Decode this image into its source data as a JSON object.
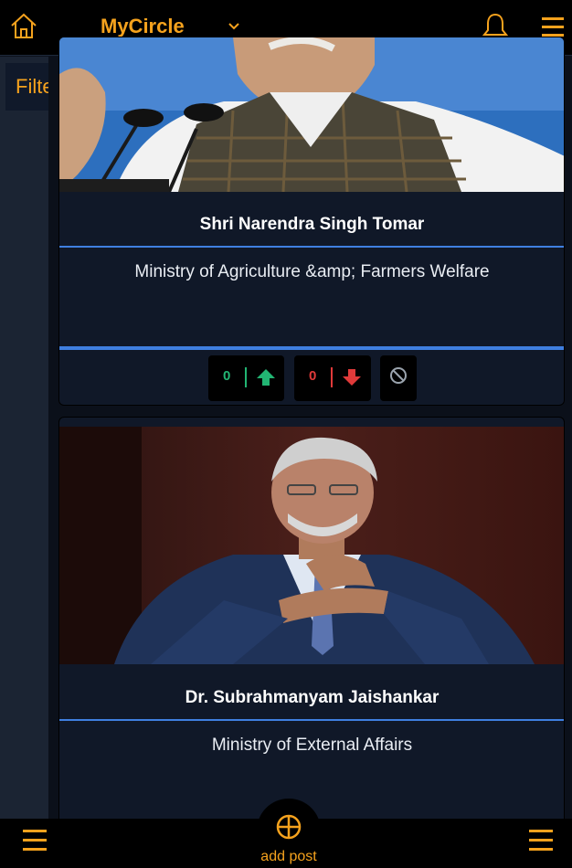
{
  "header": {
    "brand": "MyCircle",
    "accent": "#f5a21d",
    "icons": [
      "home-icon",
      "chevron-down-icon",
      "bell-icon",
      "hamburger-menu-icon"
    ]
  },
  "sidebar": {
    "filter_label": "Filter"
  },
  "cards": [
    {
      "name": "Shri Narendra Singh Tomar",
      "ministry": "Ministry of Agriculture &amp; Farmers Welfare",
      "upvotes": "0",
      "downvotes": "0"
    },
    {
      "name": "Dr. Subrahmanyam Jaishankar",
      "ministry": "Ministry of External Affairs"
    }
  ],
  "footer": {
    "add_post_label": "add post"
  },
  "colors": {
    "upvote": "#22b573",
    "downvote": "#e03a3a",
    "separator": "#3f7fe0"
  }
}
